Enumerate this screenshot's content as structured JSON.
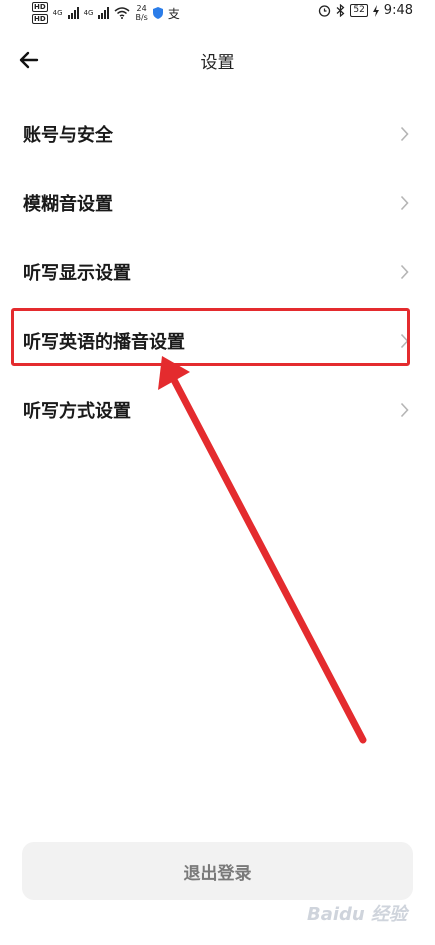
{
  "status_bar": {
    "hd_1": "HD",
    "hd_2": "HD",
    "net_1": "4G",
    "net_2": "4G",
    "speed_value": "24",
    "speed_unit": "B/s",
    "app_icon_text": "支",
    "battery": "52",
    "time": "9:48"
  },
  "header": {
    "title": "设置"
  },
  "menu": {
    "items": [
      {
        "label": "账号与安全"
      },
      {
        "label": "模糊音设置"
      },
      {
        "label": "听写显示设置"
      },
      {
        "label": "听写英语的播音设置"
      },
      {
        "label": "听写方式设置"
      }
    ]
  },
  "logout": {
    "label": "退出登录"
  },
  "annotation": {
    "color": "#e42b2e"
  },
  "watermark": {
    "text": "Baidu 经验"
  }
}
